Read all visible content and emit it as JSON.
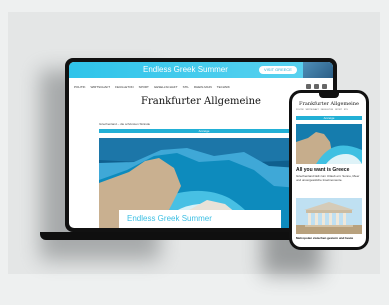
{
  "laptop": {
    "ad_banner": {
      "title": "Endless Greek Summer",
      "button_label": "VISIT GREECE"
    },
    "nav": {
      "items": [
        "POLITIK",
        "WIRTSCHAFT",
        "FEUILLETON",
        "SPORT",
        "GESELLSCHAFT",
        "STIL",
        "RHEIN-MAIN",
        "TECHNIK"
      ]
    },
    "masthead": "Frankfurter Allgemeine",
    "breadcrumb": "Griechenland – die schönsten Strände",
    "blue_bar_text": "Anzeige",
    "hero_caption": "Endless Greek Summer"
  },
  "phone": {
    "masthead": "Frankfurter Allgemeine",
    "nav_items": [
      "POLITIK",
      "WIRTSCHAFT",
      "FEUILLETON",
      "SPORT",
      "STIL"
    ],
    "blue_bar_text": "Anzeige",
    "headline": "All you want is Greece",
    "body": "Griechenland lädt zum Urlaub ein: Sonne, Meer und unvergessliche Inselmomente.",
    "image_caption": "Metropolen zwischen gestern und heute"
  }
}
